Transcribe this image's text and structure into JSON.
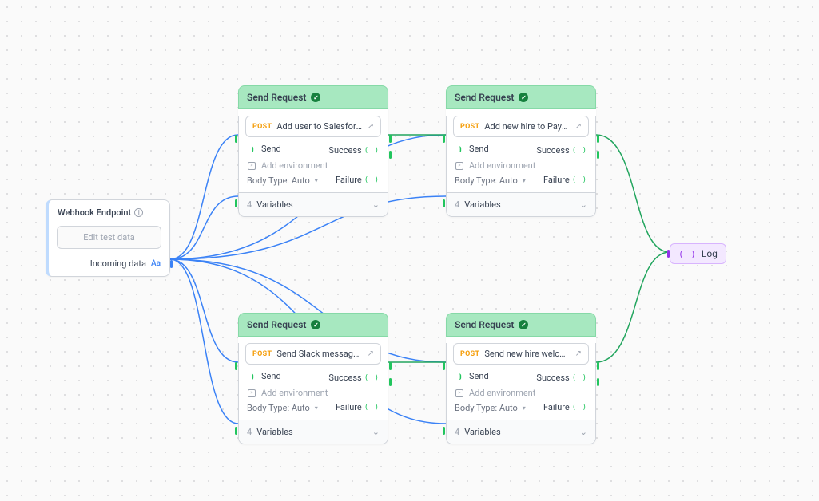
{
  "webhook": {
    "title": "Webhook Endpoint",
    "button": "Edit test data",
    "footer_label": "Incoming data",
    "aa": "Aa"
  },
  "request_common": {
    "title": "Send Request",
    "method": "POST",
    "send_label": "Send",
    "env_label": "Add environment",
    "body_type": "Body Type: Auto",
    "variables_label": "Variables",
    "variables_count": "4",
    "success_label": "Success",
    "failure_label": "Failure"
  },
  "requests": {
    "top_left": {
      "desc": "Add user to Salesforce"
    },
    "top_right": {
      "desc": "Add new hire to Payroll"
    },
    "bot_left": {
      "desc": "Send Slack message to it-team"
    },
    "bot_right": {
      "desc": "Send new hire welcome email"
    }
  },
  "log": {
    "label": "Log"
  }
}
